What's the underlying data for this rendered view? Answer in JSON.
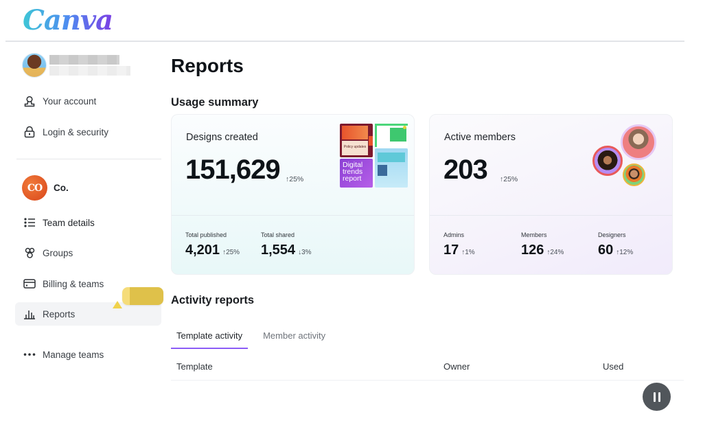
{
  "app": {
    "logo_text": "Canva"
  },
  "sidebar": {
    "profile": {
      "name": "",
      "email": ""
    },
    "account_items": [
      {
        "label": "Your account",
        "icon": "user-icon"
      },
      {
        "label": "Login & security",
        "icon": "lock-icon"
      }
    ],
    "team": {
      "name": "Co.",
      "logo_text": "CO"
    },
    "team_items": [
      {
        "label": "Team details",
        "icon": "list-icon"
      },
      {
        "label": "Groups",
        "icon": "groups-icon"
      },
      {
        "label": "Billing & teams",
        "icon": "credit-card-icon"
      },
      {
        "label": "Reports",
        "icon": "bar-chart-icon",
        "active": true
      },
      {
        "label": "Manage teams",
        "icon": "more-dots-icon"
      }
    ]
  },
  "main": {
    "title": "Reports",
    "usage_summary": {
      "heading": "Usage summary",
      "designs": {
        "label": "Designs created",
        "value": "151,629",
        "delta": "↑25%",
        "thumbnail_text": "Digital trends report",
        "thumbnail_caption": "Policy updates",
        "sub_stats": [
          {
            "label": "Total published",
            "value": "4,201",
            "delta": "↑25%"
          },
          {
            "label": "Total shared",
            "value": "1,554",
            "delta": "↓3%"
          }
        ]
      },
      "members": {
        "label": "Active members",
        "value": "203",
        "delta": "↑25%",
        "sub_stats": [
          {
            "label": "Admins",
            "value": "17",
            "delta": "↑1%"
          },
          {
            "label": "Members",
            "value": "126",
            "delta": "↑24%"
          },
          {
            "label": "Designers",
            "value": "60",
            "delta": "↑12%"
          }
        ]
      }
    },
    "activity_reports": {
      "heading": "Activity reports",
      "tabs": [
        {
          "label": "Template activity",
          "active": true
        },
        {
          "label": "Member activity",
          "active": false
        }
      ],
      "columns": [
        "Template",
        "Owner",
        "Used"
      ]
    }
  },
  "colors": {
    "accent": "#8b5cf6",
    "tooltip": "#f0d24c",
    "team_logo": "#e0541f"
  }
}
